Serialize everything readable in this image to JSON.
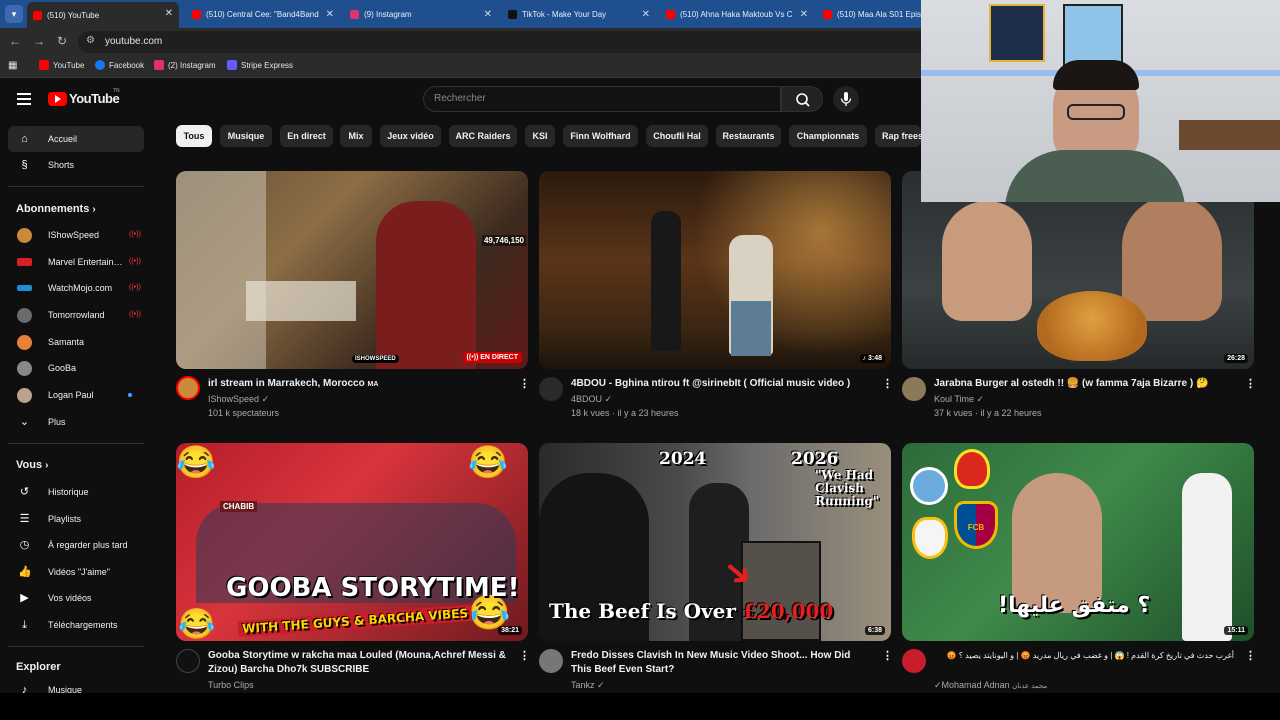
{
  "browser": {
    "tabs": [
      {
        "label": "(510) YouTube",
        "active": true,
        "icon": "youtube-icon"
      },
      {
        "label": "(510) Central Cee: \"Band4Band",
        "icon": "youtube-icon"
      },
      {
        "label": "(9) Instagram",
        "icon": "instagram-icon"
      },
      {
        "label": "TikTok - Make Your Day",
        "icon": "tiktok-icon"
      },
      {
        "label": "(510) Ahna Haka Maktoub Vs C",
        "icon": "youtube-icon"
      },
      {
        "label": "(510) Maa Ala S01 Epis",
        "icon": "youtube-icon"
      }
    ],
    "url": "youtube.com",
    "bookmarks": [
      {
        "label": "YouTube",
        "color": "#ff0000"
      },
      {
        "label": "Facebook",
        "color": "#1877f2"
      },
      {
        "label": "(2) Instagram",
        "color": "#e1306c"
      },
      {
        "label": "Stripe Express",
        "color": "#635bff"
      }
    ]
  },
  "header": {
    "logo_text": "YouTube",
    "logo_tm": "TN",
    "search_placeholder": "Rechercher"
  },
  "sidebar": {
    "main": [
      {
        "label": "Accueil",
        "icon": "home-icon",
        "active": true
      },
      {
        "label": "Shorts",
        "icon": "shorts-icon"
      }
    ],
    "subscriptions_title": "Abonnements",
    "subscriptions": [
      {
        "label": "IShowSpeed",
        "live": true,
        "color": "#c98b3a"
      },
      {
        "label": "Marvel Entertain…",
        "live": true,
        "color": "#d8202a"
      },
      {
        "label": "WatchMojo.com",
        "live": true,
        "color": "#1a8fd8"
      },
      {
        "label": "Tomorrowland",
        "live": true,
        "color": "#6b6b6b"
      },
      {
        "label": "Samanta",
        "color": "#e8823a"
      },
      {
        "label": "GooBa",
        "color": "#888888"
      },
      {
        "label": "Logan Paul",
        "new": true,
        "color": "#b9a38a"
      },
      {
        "label": "Plus",
        "icon": "chevron-down-icon"
      }
    ],
    "you_title": "Vous",
    "you": [
      {
        "label": "Historique",
        "icon": "history-icon"
      },
      {
        "label": "Playlists",
        "icon": "playlists-icon"
      },
      {
        "label": "À regarder plus tard",
        "icon": "watch-later-icon"
      },
      {
        "label": "Vidéos \"J'aime\"",
        "icon": "like-icon"
      },
      {
        "label": "Vos vidéos",
        "icon": "your-videos-icon"
      },
      {
        "label": "Téléchargements",
        "icon": "download-icon"
      }
    ],
    "explore_title": "Explorer",
    "explore": [
      {
        "label": "Musique",
        "icon": "music-icon"
      }
    ]
  },
  "chips": [
    "Tous",
    "Musique",
    "En direct",
    "Mix",
    "Jeux vidéo",
    "ARC Raiders",
    "KSI",
    "Finn Wolfhard",
    "Choufli Hal",
    "Restaurants",
    "Championnats",
    "Rap frees"
  ],
  "videos": [
    {
      "title": "irl stream in Marrakech, Morocco",
      "title_suffix": "MA",
      "channel": "IShowSpeed",
      "verified": true,
      "meta": "101 k spectateurs",
      "badge": "EN DIRECT",
      "thumb_overlay": "49,746,150",
      "logo_text": "ISHOWSPEED"
    },
    {
      "title": "4BDOU - Bghina ntirou ft @sirinebIt ( Official music video )",
      "channel": "4BDOU",
      "verified": true,
      "meta": "18 k vues · il y a 23 heures",
      "duration": "3:48"
    },
    {
      "title": "Jarabna Burger al ostedh !! 🍔 (w famma 7aja Bizarre ) 🤔",
      "channel": "Koul Time",
      "verified": true,
      "meta": "37 k vues · il y a 22 heures",
      "duration": "26:28"
    },
    {
      "title": "Gooba Storytime w rakcha maa Louled (Mouna,Achref Messi & Zizou) Barcha Dho7k SUBSCRIBE",
      "channel": "Turbo Clips",
      "verified": false,
      "meta": "",
      "duration": "38:21",
      "overlay_line1": "GOOBA STORYTIME!",
      "overlay_line2": "WITH THE GUYS & BARCHA VIBES",
      "overlay_sign": "CHABIB"
    },
    {
      "title": "Fredo Disses Clavish In New Music Video Shoot... How Did This Beef Even Start?",
      "channel": "Tankz",
      "verified": true,
      "meta": "",
      "duration": "6:38",
      "overlay_year1": "2024",
      "overlay_year2": "2026",
      "overlay_quote": "\"We Had Clavish Running\"",
      "overlay_main": "The Beef Is Over",
      "overlay_amount": "£20,000"
    },
    {
      "title": "أغرب حدث في تاريخ كرة القدم ! 😱 | و غضب في ريال مدريد 😡 | و اليونايتد يصيد ؟ 😡",
      "channel": "Mohamad Adnan",
      "channel_alt": "محمد عدنان",
      "verified": true,
      "meta": "",
      "duration": "15:11",
      "overlay_arabic": "!؟ متفق عليها",
      "club_fcb": "FCB"
    }
  ]
}
